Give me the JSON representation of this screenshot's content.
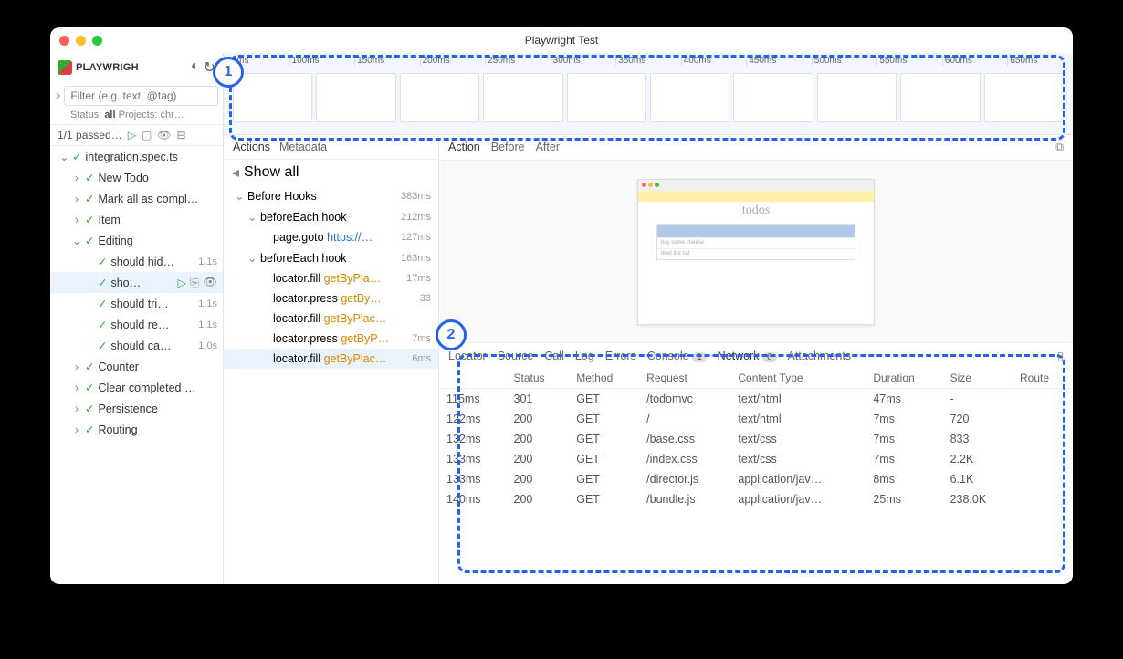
{
  "window": {
    "title": "Playwright Test"
  },
  "brand": {
    "name": "PLAYWRIGH"
  },
  "filter": {
    "placeholder": "Filter (e.g. text, @tag)"
  },
  "status_line": {
    "status_label": "Status:",
    "status_value": "all",
    "projects_label": "Projects:",
    "projects_value": "chr…"
  },
  "toolbar": {
    "passed": "1/1 passed…"
  },
  "tree": [
    {
      "indent": 0,
      "chev": "⌄",
      "label": "integration.spec.ts",
      "time": ""
    },
    {
      "indent": 1,
      "chev": "›",
      "label": "New Todo",
      "time": ""
    },
    {
      "indent": 1,
      "chev": "›",
      "label": "Mark all as compl…",
      "time": ""
    },
    {
      "indent": 1,
      "chev": "›",
      "label": "Item",
      "time": ""
    },
    {
      "indent": 1,
      "chev": "⌄",
      "label": "Editing",
      "time": ""
    },
    {
      "indent": 2,
      "chev": "",
      "label": "should hid…",
      "time": "1.1s"
    },
    {
      "indent": 2,
      "chev": "",
      "label": "sho…",
      "time": "",
      "selected": true,
      "showIcons": true
    },
    {
      "indent": 2,
      "chev": "",
      "label": "should tri…",
      "time": "1.1s"
    },
    {
      "indent": 2,
      "chev": "",
      "label": "should re…",
      "time": "1.1s"
    },
    {
      "indent": 2,
      "chev": "",
      "label": "should ca…",
      "time": "1.0s"
    },
    {
      "indent": 1,
      "chev": "›",
      "label": "Counter",
      "time": ""
    },
    {
      "indent": 1,
      "chev": "›",
      "label": "Clear completed …",
      "time": ""
    },
    {
      "indent": 1,
      "chev": "›",
      "label": "Persistence",
      "time": ""
    },
    {
      "indent": 1,
      "chev": "›",
      "label": "Routing",
      "time": ""
    }
  ],
  "timeline_ticks": [
    "50ms",
    "100ms",
    "150ms",
    "200ms",
    "250ms",
    "300ms",
    "350ms",
    "400ms",
    "450ms",
    "500ms",
    "550ms",
    "600ms",
    "650ms"
  ],
  "actions_tabs": {
    "actions": "Actions",
    "metadata": "Metadata"
  },
  "show_all": "Show all",
  "actions": [
    {
      "indent": 0,
      "chev": "⌄",
      "text": "Before Hooks",
      "time": "383ms"
    },
    {
      "indent": 1,
      "chev": "⌄",
      "text": "beforeEach hook",
      "time": "212ms"
    },
    {
      "indent": 2,
      "chev": "",
      "text": "page.goto",
      "arg": "https://…",
      "argClass": "action-link",
      "time": "127ms"
    },
    {
      "indent": 1,
      "chev": "⌄",
      "text": "beforeEach hook",
      "time": "163ms"
    },
    {
      "indent": 2,
      "chev": "",
      "text": "locator.fill",
      "arg": "getByPla…",
      "time": "17ms"
    },
    {
      "indent": 2,
      "chev": "",
      "text": "locator.press",
      "arg": "getBy…",
      "time": "33"
    },
    {
      "indent": 2,
      "chev": "",
      "text": "locator.fill",
      "arg": "getByPlac…",
      "time": ""
    },
    {
      "indent": 2,
      "chev": "",
      "text": "locator.press",
      "arg": "getByP…",
      "time": "7ms"
    },
    {
      "indent": 2,
      "chev": "",
      "text": "locator.fill",
      "arg": "getByPlac…",
      "time": "6ms",
      "selected": true
    }
  ],
  "preview_tabs": {
    "action": "Action",
    "before": "Before",
    "after": "After"
  },
  "mini": {
    "title": "todos",
    "line1": "buy some cheese",
    "line2": "feed the cat"
  },
  "bottom_tabs": {
    "locator": "Locator",
    "source": "Source",
    "call": "Call",
    "log": "Log",
    "errors": "Errors",
    "console": "Console",
    "console_count": "1",
    "network": "Network",
    "network_count": "6",
    "attachments": "Attachments"
  },
  "network": {
    "headers": {
      "start": "",
      "status": "Status",
      "method": "Method",
      "request": "Request",
      "ctype": "Content Type",
      "duration": "Duration",
      "size": "Size",
      "route": "Route"
    },
    "rows": [
      {
        "start": "115ms",
        "status": "301",
        "method": "GET",
        "request": "/todomvc",
        "ctype": "text/html",
        "duration": "47ms",
        "size": "-",
        "route": ""
      },
      {
        "start": "122ms",
        "status": "200",
        "method": "GET",
        "request": "/",
        "ctype": "text/html",
        "duration": "7ms",
        "size": "720",
        "route": ""
      },
      {
        "start": "132ms",
        "status": "200",
        "method": "GET",
        "request": "/base.css",
        "ctype": "text/css",
        "duration": "7ms",
        "size": "833",
        "route": ""
      },
      {
        "start": "133ms",
        "status": "200",
        "method": "GET",
        "request": "/index.css",
        "ctype": "text/css",
        "duration": "7ms",
        "size": "2.2K",
        "route": ""
      },
      {
        "start": "133ms",
        "status": "200",
        "method": "GET",
        "request": "/director.js",
        "ctype": "application/jav…",
        "duration": "8ms",
        "size": "6.1K",
        "route": ""
      },
      {
        "start": "140ms",
        "status": "200",
        "method": "GET",
        "request": "/bundle.js",
        "ctype": "application/jav…",
        "duration": "25ms",
        "size": "238.0K",
        "route": ""
      }
    ]
  },
  "annotations": {
    "one": "1",
    "two": "2"
  }
}
